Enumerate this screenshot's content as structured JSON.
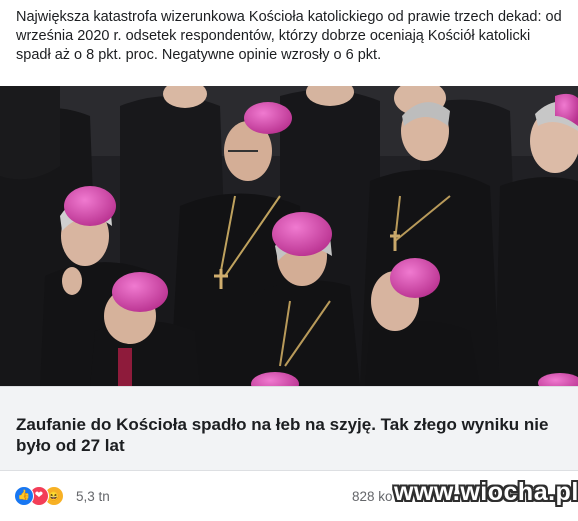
{
  "post": {
    "text": "Największa katastrofa wizerunkowa Kościoła katolickiego od prawie trzech dekad: od września 2020 r. odsetek respondentów, którzy dobrze oceniają Kościół katolicki spadł aż o 8 pkt. proc. Negatywne opinie wzrosły o 6 pkt."
  },
  "link_preview": {
    "title": "Zaufanie do Kościoła spadło na łeb na szyję. Tak złego wyniku nie było od 27 lat"
  },
  "reactions": {
    "icons": [
      "like-icon",
      "love-icon",
      "haha-icon"
    ],
    "count": "5,3 tn",
    "comments": "828 ko"
  },
  "watermark": "www.wiocha.pl",
  "colors": {
    "zucchetto": "#d94fae",
    "cassock": "#141416",
    "like": "#1877f2",
    "love": "#f33e58",
    "haha": "#f7b125"
  }
}
